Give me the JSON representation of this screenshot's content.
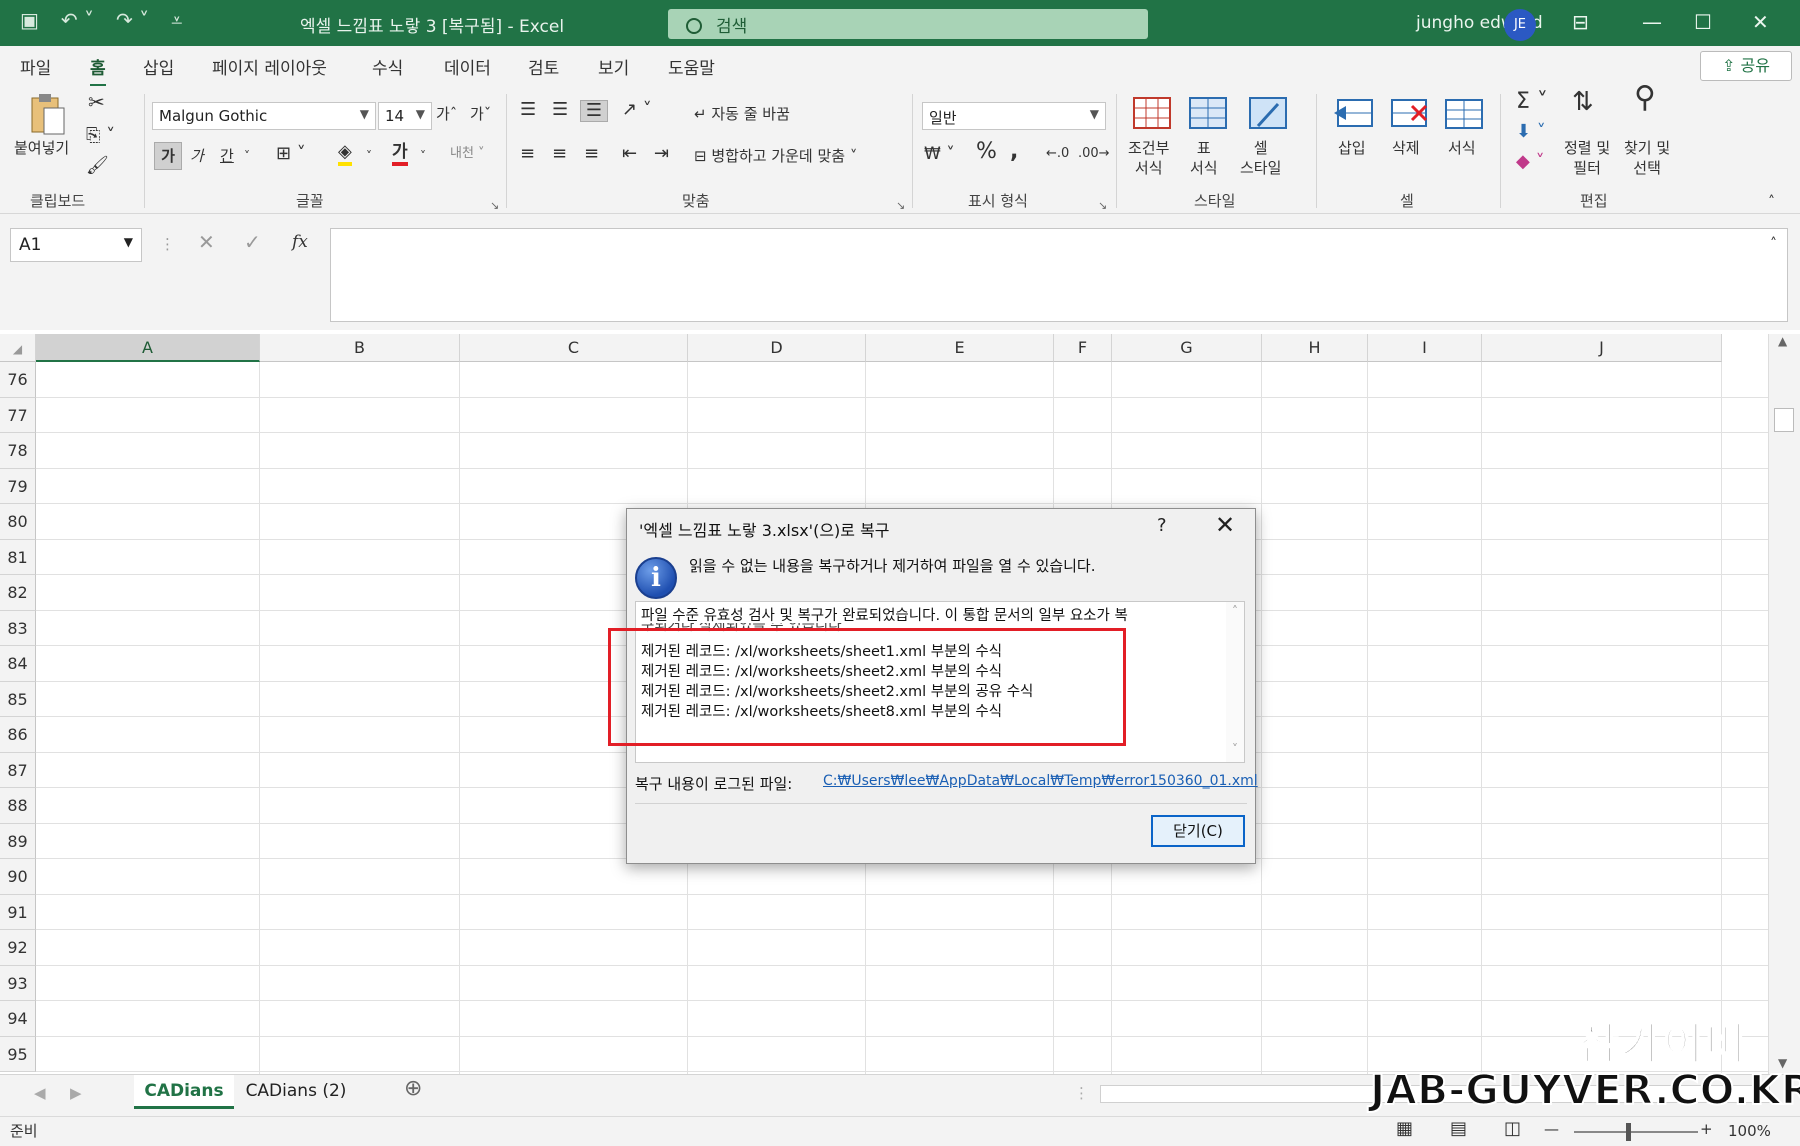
{
  "titlebar": {
    "document_title": "엑셀 느낌표 노랗 3 [복구됨]  -  Excel",
    "search_placeholder": "검색",
    "user_name": "jungho edword",
    "user_initials": "JE"
  },
  "tabs": [
    "파일",
    "홈",
    "삽입",
    "페이지 레이아웃",
    "수식",
    "데이터",
    "검토",
    "보기",
    "도움말"
  ],
  "active_tab": "홈",
  "share_label": "공유",
  "ribbon": {
    "clipboard": {
      "paste_label": "붙여넣기",
      "group_label": "클립보드"
    },
    "font": {
      "font_name": "Malgun Gothic",
      "font_size": "14",
      "grow": "가ˆ",
      "shrink": "가ˇ",
      "bold": "가",
      "italic": "가",
      "underline": "간",
      "group_label": "글꼴"
    },
    "alignment": {
      "wrap_label": "자동 줄 바꿈",
      "merge_label": "병합하고 가운데 맞춤",
      "group_label": "맞춤"
    },
    "number": {
      "format": "일반",
      "group_label": "표시 형식"
    },
    "styles": {
      "conditional": "조건부\n서식",
      "table": "표\n서식",
      "cell_styles": "셀\n스타일",
      "group_label": "스타일"
    },
    "cells": {
      "insert": "삽입",
      "delete": "삭제",
      "format": "서식",
      "group_label": "셀"
    },
    "editing": {
      "sort": "정렬 및\n필터",
      "find": "찾기 및\n선택",
      "group_label": "편집"
    }
  },
  "formula_bar": {
    "name_box": "A1",
    "formula": ""
  },
  "columns": [
    "A",
    "B",
    "C",
    "D",
    "E",
    "F",
    "G",
    "H",
    "I",
    "J"
  ],
  "rows": [
    "76",
    "77",
    "78",
    "79",
    "80",
    "81",
    "82",
    "83",
    "84",
    "85",
    "86",
    "87",
    "88",
    "89",
    "90",
    "91",
    "92",
    "93",
    "94",
    "95"
  ],
  "sheets": {
    "tabs": [
      "CADians",
      "CADians (2)"
    ],
    "active": "CADians"
  },
  "status": {
    "ready": "준비",
    "zoom": "100%"
  },
  "dialog": {
    "title": "'엑셀 느낌표 노랗 3.xlsx'(으)로 복구",
    "help": "?",
    "message": "읽을 수 없는 내용을 복구하거나 제거하여 파일을 열 수 있습니다.",
    "details": [
      "파일 수준 유효성 검사 및 복구가 완료되었습니다. 이 통합 문서의 일부 요소가 복",
      "구되거나 삭제되었을 수 있습니다.",
      "제거된 레코드: /xl/worksheets/sheet1.xml 부분의 수식",
      "제거된 레코드: /xl/worksheets/sheet2.xml 부분의 수식",
      "제거된 레코드: /xl/worksheets/sheet2.xml 부분의 공유 수식",
      "제거된 레코드: /xl/worksheets/sheet8.xml 부분의 수식"
    ],
    "log_label": "복구 내용이 로그된 파일:",
    "log_path": "C:₩Users₩lee₩AppData₩Local₩Temp₩error150360_01.xml",
    "close_label": "닫기(C)"
  },
  "watermark": {
    "line1": "잡가이버",
    "line2": "JAB-GUYVER.CO.KR"
  },
  "colors": {
    "excel_green": "#217346",
    "highlight_red": "#e21e26",
    "link_blue": "#1a5fb4"
  }
}
